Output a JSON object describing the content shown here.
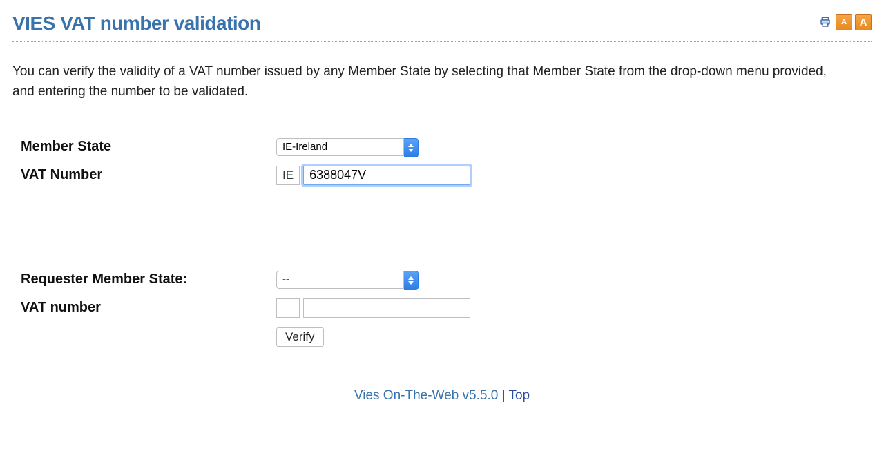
{
  "header": {
    "title": "VIES VAT number validation",
    "tools": {
      "print_label": "Print",
      "font_small_label": "A",
      "font_large_label": "A"
    }
  },
  "intro_text": "You can verify the validity of a VAT number issued by any Member State by selecting that Member State from the drop-down menu provided, and entering the number to be validated.",
  "form": {
    "member_state": {
      "label": "Member State",
      "selected": "IE-Ireland",
      "prefix": "IE"
    },
    "vat_number": {
      "label": "VAT Number",
      "value": "6388047V"
    },
    "requester_member_state": {
      "label": "Requester Member State:",
      "selected": "--",
      "prefix": ""
    },
    "requester_vat_number": {
      "label": "VAT number",
      "value": ""
    },
    "verify_button": "Verify"
  },
  "footer": {
    "version_text": "Vies On-The-Web v5.5.0",
    "separator": " | ",
    "top_link": "Top"
  }
}
